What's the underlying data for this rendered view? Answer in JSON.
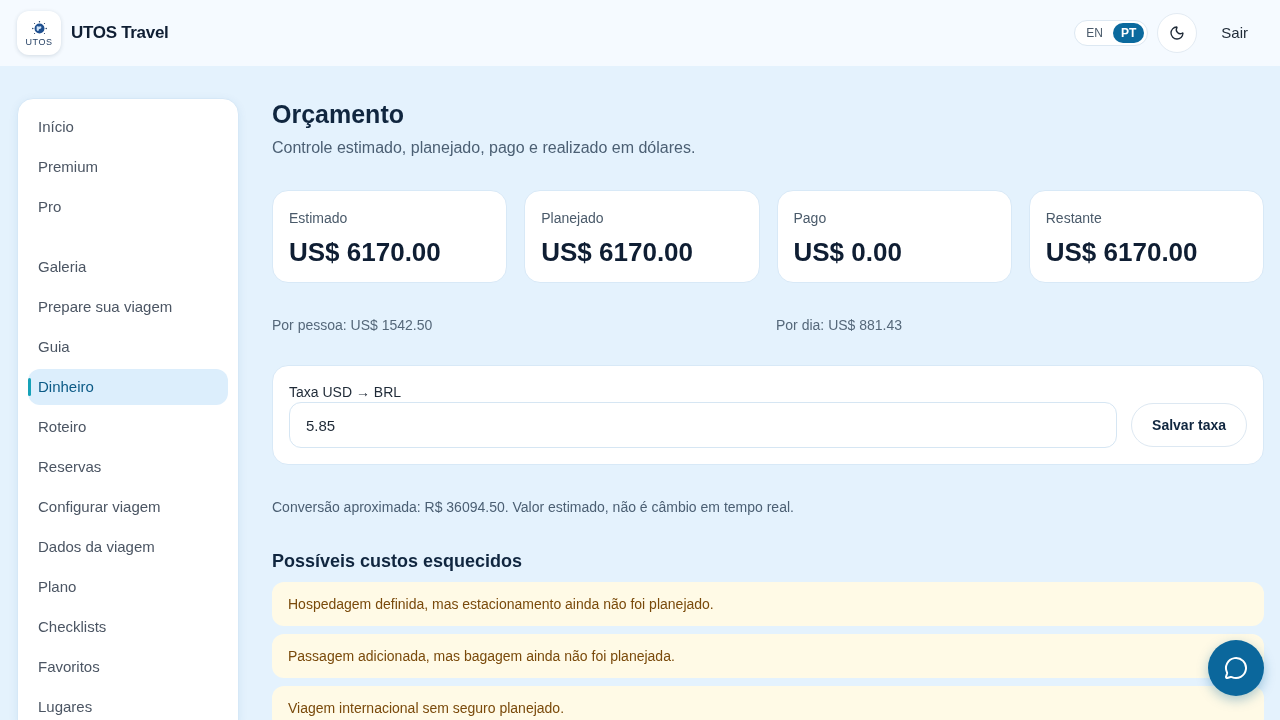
{
  "header": {
    "brand": {
      "logo_text": "UTOS",
      "name": "UTOS Travel"
    },
    "languages": [
      {
        "label": "EN",
        "selected": false
      },
      {
        "label": "PT",
        "selected": true
      }
    ],
    "logout": "Sair"
  },
  "sidebar": {
    "groups": [
      {
        "items": [
          {
            "label": "Início",
            "selected": false
          },
          {
            "label": "Premium",
            "selected": false
          },
          {
            "label": "Pro",
            "selected": false
          }
        ]
      },
      {
        "items": [
          {
            "label": "Galeria",
            "selected": false
          },
          {
            "label": "Prepare sua viagem",
            "selected": false
          },
          {
            "label": "Guia",
            "selected": false
          },
          {
            "label": "Dinheiro",
            "selected": true
          },
          {
            "label": "Roteiro",
            "selected": false
          },
          {
            "label": "Reservas",
            "selected": false
          },
          {
            "label": "Configurar viagem",
            "selected": false
          },
          {
            "label": "Dados da viagem",
            "selected": false
          },
          {
            "label": "Plano",
            "selected": false
          },
          {
            "label": "Checklists",
            "selected": false
          },
          {
            "label": "Favoritos",
            "selected": false
          },
          {
            "label": "Lugares",
            "selected": false
          }
        ]
      }
    ]
  },
  "page": {
    "title": "Orçamento",
    "subtitle": "Controle estimado, planejado, pago e realizado em dólares."
  },
  "stats": [
    {
      "label": "Estimado",
      "value": "US$ 6170.00"
    },
    {
      "label": "Planejado",
      "value": "US$ 6170.00"
    },
    {
      "label": "Pago",
      "value": "US$ 0.00"
    },
    {
      "label": "Restante",
      "value": "US$ 6170.00"
    }
  ],
  "averages": {
    "per_person": "Por pessoa: US$ 1542.50",
    "per_day": "Por dia: US$ 881.43"
  },
  "rate_form": {
    "label": "Taxa USD → BRL",
    "value": "5.85",
    "button": "Salvar taxa"
  },
  "conversion_note": "Conversão aproximada: R$ 36094.50. Valor estimado, não é câmbio em tempo real.",
  "forgotten_costs": {
    "title": "Possíveis custos esquecidos",
    "items": [
      "Hospedagem definida, mas estacionamento ainda não foi planejado.",
      "Passagem adicionada, mas bagagem ainda não foi planejada.",
      "Viagem internacional sem seguro planejado."
    ]
  }
}
